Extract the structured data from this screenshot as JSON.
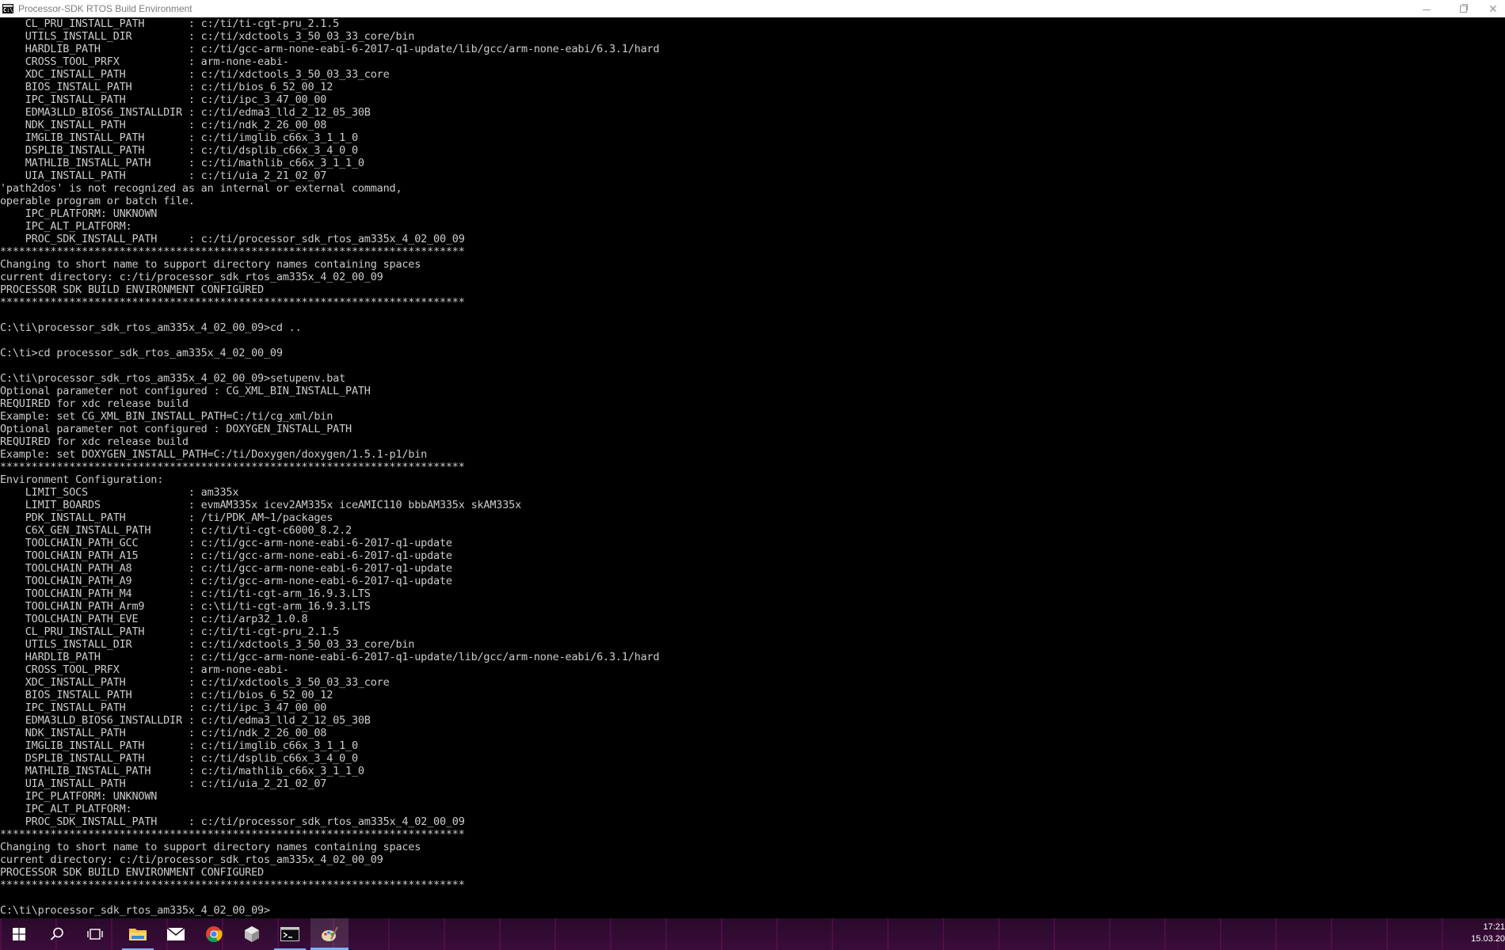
{
  "window": {
    "title": "Processor-SDK RTOS Build Environment",
    "minimize_label": "",
    "restore_label": "",
    "close_label": "✕"
  },
  "console": {
    "lines": [
      "    CL_PRU_INSTALL_PATH       : c:/ti/ti-cgt-pru_2.1.5",
      "    UTILS_INSTALL_DIR         : c:/ti/xdctools_3_50_03_33_core/bin",
      "    HARDLIB_PATH              : c:/ti/gcc-arm-none-eabi-6-2017-q1-update/lib/gcc/arm-none-eabi/6.3.1/hard",
      "    CROSS_TOOL_PRFX           : arm-none-eabi-",
      "    XDC_INSTALL_PATH          : c:/ti/xdctools_3_50_03_33_core",
      "    BIOS_INSTALL_PATH         : c:/ti/bios_6_52_00_12",
      "    IPC_INSTALL_PATH          : c:/ti/ipc_3_47_00_00",
      "    EDMA3LLD_BIOS6_INSTALLDIR : c:/ti/edma3_lld_2_12_05_30B",
      "    NDK_INSTALL_PATH          : c:/ti/ndk_2_26_00_08",
      "    IMGLIB_INSTALL_PATH       : c:/ti/imglib_c66x_3_1_1_0",
      "    DSPLIB_INSTALL_PATH       : c:/ti/dsplib_c66x_3_4_0_0",
      "    MATHLIB_INSTALL_PATH      : c:/ti/mathlib_c66x_3_1_1_0",
      "    UIA_INSTALL_PATH          : c:/ti/uia_2_21_02_07",
      "'path2dos' is not recognized as an internal or external command,",
      "operable program or batch file.",
      "    IPC_PLATFORM: UNKNOWN",
      "    IPC_ALT_PLATFORM:",
      "    PROC_SDK_INSTALL_PATH     : c:/ti/processor_sdk_rtos_am335x_4_02_00_09",
      "**************************************************************************",
      "Changing to short name to support directory names containing spaces",
      "current directory: c:/ti/processor_sdk_rtos_am335x_4_02_00_09",
      "PROCESSOR SDK BUILD ENVIRONMENT CONFIGURED",
      "**************************************************************************",
      "",
      "C:\\ti\\processor_sdk_rtos_am335x_4_02_00_09>cd ..",
      "",
      "C:\\ti>cd processor_sdk_rtos_am335x_4_02_00_09",
      "",
      "C:\\ti\\processor_sdk_rtos_am335x_4_02_00_09>setupenv.bat",
      "Optional parameter not configured : CG_XML_BIN_INSTALL_PATH",
      "REQUIRED for xdc release build",
      "Example: set CG_XML_BIN_INSTALL_PATH=C:/ti/cg_xml/bin",
      "Optional parameter not configured : DOXYGEN_INSTALL_PATH",
      "REQUIRED for xdc release build",
      "Example: set DOXYGEN_INSTALL_PATH=C:/ti/Doxygen/doxygen/1.5.1-p1/bin",
      "**************************************************************************",
      "Environment Configuration:",
      "    LIMIT_SOCS                : am335x",
      "    LIMIT_BOARDS              : evmAM335x icev2AM335x iceAMIC110 bbbAM335x skAM335x",
      "    PDK_INSTALL_PATH          : /ti/PDK_AM~1/packages",
      "    C6X_GEN_INSTALL_PATH      : c:/ti/ti-cgt-c6000_8.2.2",
      "    TOOLCHAIN_PATH_GCC        : c:/ti/gcc-arm-none-eabi-6-2017-q1-update",
      "    TOOLCHAIN_PATH_A15        : c:/ti/gcc-arm-none-eabi-6-2017-q1-update",
      "    TOOLCHAIN_PATH_A8         : c:/ti/gcc-arm-none-eabi-6-2017-q1-update",
      "    TOOLCHAIN_PATH_A9         : c:/ti/gcc-arm-none-eabi-6-2017-q1-update",
      "    TOOLCHAIN_PATH_M4         : c:/ti/ti-cgt-arm_16.9.3.LTS",
      "    TOOLCHAIN_PATH_Arm9       : c:\\ti/ti-cgt-arm_16.9.3.LTS",
      "    TOOLCHAIN_PATH_EVE        : c:/ti/arp32_1.0.8",
      "    CL_PRU_INSTALL_PATH       : c:/ti/ti-cgt-pru_2.1.5",
      "    UTILS_INSTALL_DIR         : c:/ti/xdctools_3_50_03_33_core/bin",
      "    HARDLIB_PATH              : c:/ti/gcc-arm-none-eabi-6-2017-q1-update/lib/gcc/arm-none-eabi/6.3.1/hard",
      "    CROSS_TOOL_PRFX           : arm-none-eabi-",
      "    XDC_INSTALL_PATH          : c:/ti/xdctools_3_50_03_33_core",
      "    BIOS_INSTALL_PATH         : c:/ti/bios_6_52_00_12",
      "    IPC_INSTALL_PATH          : c:/ti/ipc_3_47_00_00",
      "    EDMA3LLD_BIOS6_INSTALLDIR : c:/ti/edma3_lld_2_12_05_30B",
      "    NDK_INSTALL_PATH          : c:/ti/ndk_2_26_00_08",
      "    IMGLIB_INSTALL_PATH       : c:/ti/imglib_c66x_3_1_1_0",
      "    DSPLIB_INSTALL_PATH       : c:/ti/dsplib_c66x_3_4_0_0",
      "    MATHLIB_INSTALL_PATH      : c:/ti/mathlib_c66x_3_1_1_0",
      "    UIA_INSTALL_PATH          : c:/ti/uia_2_21_02_07",
      "    IPC_PLATFORM: UNKNOWN",
      "    IPC_ALT_PLATFORM:",
      "    PROC_SDK_INSTALL_PATH     : c:/ti/processor_sdk_rtos_am335x_4_02_00_09",
      "**************************************************************************",
      "Changing to short name to support directory names containing spaces",
      "current directory: c:/ti/processor_sdk_rtos_am335x_4_02_00_09",
      "PROCESSOR SDK BUILD ENVIRONMENT CONFIGURED",
      "**************************************************************************",
      "",
      "C:\\ti\\processor_sdk_rtos_am335x_4_02_00_09>"
    ]
  },
  "taskbar": {
    "items": [
      {
        "name": "start-button",
        "icon": "windows-logo-icon"
      },
      {
        "name": "search-button",
        "icon": "search-icon"
      },
      {
        "name": "task-view-button",
        "icon": "task-view-icon"
      },
      {
        "name": "file-explorer-button",
        "icon": "folder-icon"
      },
      {
        "name": "mail-button",
        "icon": "mail-icon"
      },
      {
        "name": "chrome-button",
        "icon": "chrome-icon"
      },
      {
        "name": "package-app-button",
        "icon": "cube-icon"
      },
      {
        "name": "command-prompt-button",
        "icon": "terminal-icon"
      },
      {
        "name": "paint-app-button",
        "icon": "paint-icon"
      }
    ],
    "clock": {
      "time": "17:21",
      "date": "15.03.20"
    }
  },
  "colors": {
    "console_bg": "#000000",
    "console_fg": "#cccccc",
    "taskbar_bg": "#2a0a2a",
    "accent": "#7ab4ff"
  }
}
